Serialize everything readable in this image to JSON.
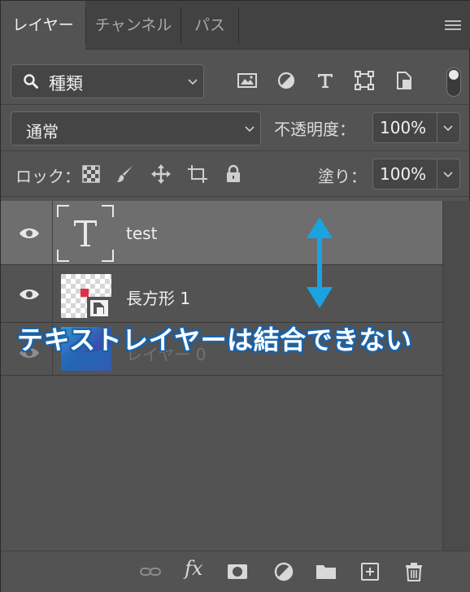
{
  "tabs": [
    {
      "label": "レイヤー",
      "active": true
    },
    {
      "label": "チャンネル",
      "active": false
    },
    {
      "label": "パス",
      "active": false
    }
  ],
  "filter": {
    "kind_label": "種類",
    "icon": "search-icon"
  },
  "blend": {
    "mode": "通常",
    "opacity_label": "不透明度：",
    "opacity": "100%"
  },
  "lock": {
    "label": "ロック：",
    "fill_label": "塗り：",
    "fill": "100%"
  },
  "layers": [
    {
      "name": "test",
      "type": "text",
      "visible": true,
      "selected": true
    },
    {
      "name": "長方形 1",
      "type": "smart-object",
      "visible": true,
      "selected": false
    },
    {
      "name": "レイヤー 0",
      "type": "image",
      "visible": false,
      "selected": false
    }
  ],
  "annotation": "テキストレイヤーは結合できない",
  "colors": {
    "accent_arrow": "#1aa3e0",
    "annotation_outline": "#1a5ea3",
    "panel_bg": "#535353",
    "selected_row": "#6e6e6e"
  }
}
